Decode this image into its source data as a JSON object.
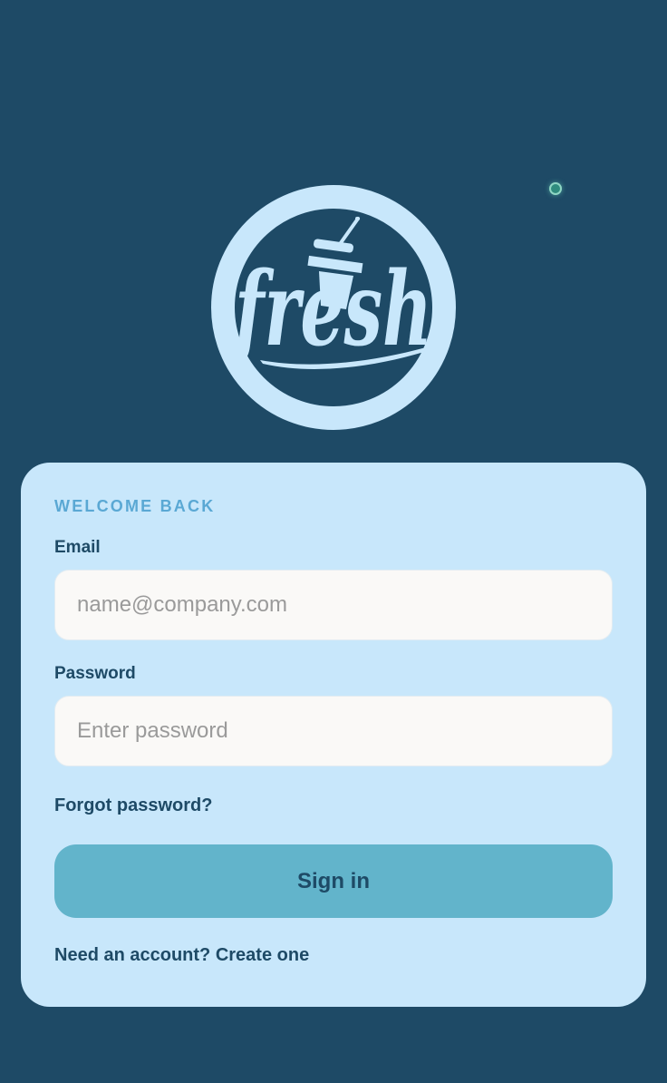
{
  "logo": {
    "text": "fresh",
    "icon": "fresh-drink-logo-icon"
  },
  "status": {
    "icon": "status-dot-icon"
  },
  "login": {
    "eyebrow": "WELCOME BACK",
    "email_label": "Email",
    "email_placeholder": "name@company.com",
    "email_value": "",
    "password_label": "Password",
    "password_placeholder": "Enter password",
    "password_value": "",
    "forgot_password": "Forgot password?",
    "sign_in": "Sign in",
    "signup_prompt": "Need an account?",
    "signup_link": "Create one"
  },
  "colors": {
    "background": "#1e4a66",
    "card": "#c8e7fb",
    "button": "#62b4cb",
    "accent_text": "#5aa8d4",
    "status_dot": "#2f8c7e"
  }
}
